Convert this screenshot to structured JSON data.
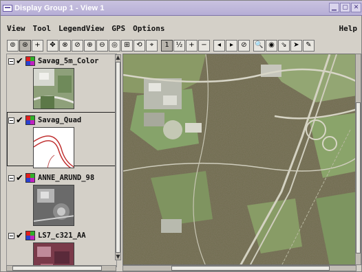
{
  "window": {
    "title": "Display Group 1 - View 1"
  },
  "menubar": {
    "items": [
      "View",
      "Tool",
      "LegendView",
      "GPS",
      "Options"
    ],
    "help": "Help"
  },
  "toolbar": {
    "buttons": [
      {
        "name": "spatial-select-icon",
        "glyph": "⊚"
      },
      {
        "name": "point-select-icon",
        "glyph": "⊛",
        "pressed": true
      },
      {
        "name": "add-layer-icon",
        "glyph": "+",
        "gap": true
      },
      {
        "name": "pan-icon",
        "glyph": "✥"
      },
      {
        "name": "zoom-box-icon",
        "glyph": "⊗"
      },
      {
        "name": "zoom-icon",
        "glyph": "⊘"
      },
      {
        "name": "zoom-in-icon",
        "glyph": "⊕"
      },
      {
        "name": "zoom-out-icon",
        "glyph": "⊖"
      },
      {
        "name": "zoom-to-layer-icon",
        "glyph": "◎"
      },
      {
        "name": "zoom-full-icon",
        "glyph": "⊞"
      },
      {
        "name": "redraw-icon",
        "glyph": "⟲"
      },
      {
        "name": "measure-icon",
        "glyph": "⌖",
        "gap": true
      },
      {
        "name": "scale-1-icon",
        "glyph": "1",
        "pressed": true
      },
      {
        "name": "scale-2-icon",
        "glyph": "½"
      },
      {
        "name": "scale-plus-icon",
        "glyph": "+"
      },
      {
        "name": "scale-minus-icon",
        "glyph": "−",
        "gap": true
      },
      {
        "name": "previous-view-icon",
        "glyph": "◂"
      },
      {
        "name": "next-view-icon",
        "glyph": "▸"
      },
      {
        "name": "cancel-redraw-icon",
        "glyph": "⊘",
        "gap": true
      },
      {
        "name": "magnify-icon",
        "glyph": "🔍"
      },
      {
        "name": "gps-icon",
        "glyph": "◉"
      },
      {
        "name": "marker-icon",
        "glyph": "⇘"
      },
      {
        "name": "arrow-pointer-icon",
        "glyph": "➤"
      },
      {
        "name": "pencil-icon",
        "glyph": "✎"
      }
    ]
  },
  "legend": {
    "layers": [
      {
        "name": "Savag_5m_Color",
        "checked": "✔",
        "thumb": "color"
      },
      {
        "name": "Savag_Quad",
        "checked": "✔",
        "thumb": "quad",
        "selected": true
      },
      {
        "name": "ANNE_ARUND_98",
        "checked": "✔",
        "thumb": "gray"
      },
      {
        "name": "LS7_c321_AA",
        "checked": "✔",
        "thumb": "landsat"
      }
    ]
  },
  "colors": {
    "title_bar": "#b6aed6",
    "selected_border": "#202020"
  }
}
